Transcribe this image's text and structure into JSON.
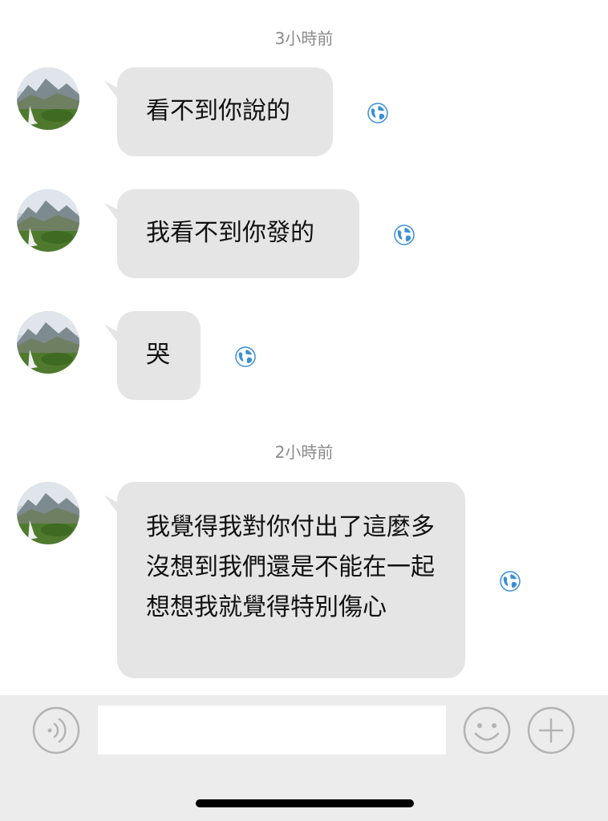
{
  "chat": {
    "timestamps": [
      "3小時前",
      "2小時前"
    ],
    "messages": [
      {
        "text": "看不到你說的"
      },
      {
        "text": "我看不到你發的"
      },
      {
        "text": "哭"
      },
      {
        "text": "我覺得我對你付出了這麼多沒想到我們還是不能在一起想想我就覺得特別傷心"
      }
    ]
  },
  "input_bar": {
    "text_input_value": ""
  },
  "colors": {
    "bubble": "#e5e5e5",
    "timestamp": "#8a8a8a",
    "input_bar_bg": "#ececec",
    "icon_gray": "#b3b3b3",
    "globe_blue": "#3a8fd6"
  }
}
